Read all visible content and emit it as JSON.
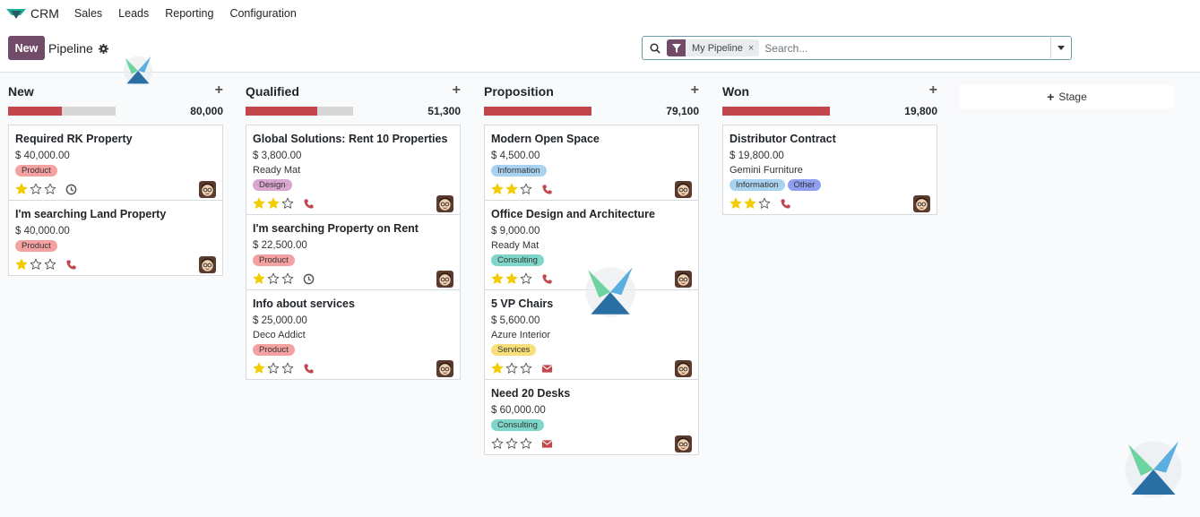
{
  "app": {
    "name": "CRM"
  },
  "menu": [
    "Sales",
    "Leads",
    "Reporting",
    "Configuration"
  ],
  "control": {
    "new_label": "New",
    "breadcrumb": "Pipeline"
  },
  "search": {
    "facet": "My Pipeline",
    "facet_close": "×",
    "placeholder": "Search..."
  },
  "add_stage": {
    "plus": "+",
    "label": "Stage"
  },
  "colors": {
    "accent": "#714b67",
    "progress": "#c2474d",
    "star": "#f3cc00"
  },
  "tag_colors": {
    "Product": "#f4a1a1",
    "Information": "#a8d2ef",
    "Design": "#d9a6cf",
    "Consulting": "#7dd6c9",
    "Services": "#f8df7a",
    "Other": "#8f9ff0"
  },
  "columns": [
    {
      "title": "New",
      "total": "80,000",
      "progress": 0.5,
      "cards": [
        {
          "title": "Required RK Property",
          "amount": "$ 40,000.00",
          "customer": "",
          "tags": [
            "Product"
          ],
          "stars": 1,
          "activity": "clock"
        },
        {
          "title": "I'm searching Land Property",
          "amount": "$ 40,000.00",
          "customer": "",
          "tags": [
            "Product"
          ],
          "stars": 1,
          "activity": "phone"
        }
      ]
    },
    {
      "title": "Qualified",
      "total": "51,300",
      "progress": 0.67,
      "cards": [
        {
          "title": "Global Solutions: Rent 10 Properties",
          "amount": "$ 3,800.00",
          "customer": "Ready Mat",
          "tags": [
            "Design"
          ],
          "stars": 2,
          "activity": "phone"
        },
        {
          "title": "I'm searching Property on Rent",
          "amount": "$ 22,500.00",
          "customer": "",
          "tags": [
            "Product"
          ],
          "stars": 1,
          "activity": "clock"
        },
        {
          "title": "Info about services",
          "amount": "$ 25,000.00",
          "customer": "Deco Addict",
          "tags": [
            "Product"
          ],
          "stars": 1,
          "activity": "phone"
        }
      ]
    },
    {
      "title": "Proposition",
      "total": "79,100",
      "progress": 1,
      "cards": [
        {
          "title": "Modern Open Space",
          "amount": "$ 4,500.00",
          "customer": "",
          "tags": [
            "Information"
          ],
          "stars": 2,
          "activity": "phone"
        },
        {
          "title": "Office Design and Architecture",
          "amount": "$ 9,000.00",
          "customer": "Ready Mat",
          "tags": [
            "Consulting"
          ],
          "stars": 2,
          "activity": "phone"
        },
        {
          "title": "5 VP Chairs",
          "amount": "$ 5,600.00",
          "customer": "Azure Interior",
          "tags": [
            "Services"
          ],
          "stars": 1,
          "activity": "email"
        },
        {
          "title": "Need 20 Desks",
          "amount": "$ 60,000.00",
          "customer": "",
          "tags": [
            "Consulting"
          ],
          "stars": 0,
          "activity": "email"
        }
      ]
    },
    {
      "title": "Won",
      "total": "19,800",
      "progress": 1,
      "cards": [
        {
          "title": "Distributor Contract",
          "amount": "$ 19,800.00",
          "customer": "Gemini Furniture",
          "tags": [
            "Information",
            "Other"
          ],
          "stars": 2,
          "activity": "phone"
        }
      ]
    }
  ]
}
